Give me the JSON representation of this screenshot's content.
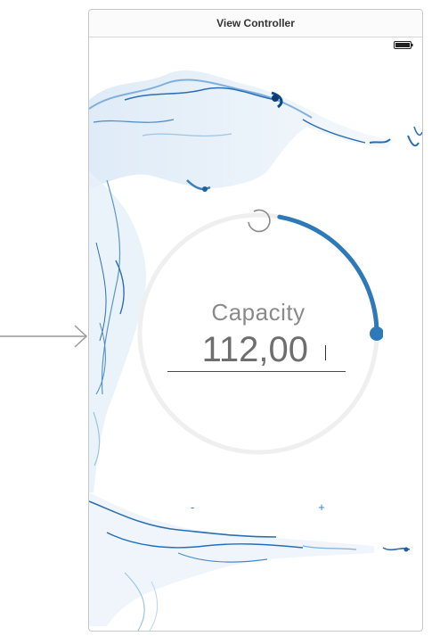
{
  "scene": {
    "title": "View Controller"
  },
  "gauge": {
    "label": "Capacity",
    "value": "112,00",
    "progress_fraction": 0.25,
    "track_color": "#eeeeee",
    "progress_color": "#2e7ab8",
    "reset_icon": "refresh-icon"
  },
  "stepper": {
    "minus_label": "-",
    "plus_label": "+"
  },
  "status_bar": {
    "battery_icon": "battery-icon"
  },
  "colors": {
    "water": "#1f6fbf",
    "water_light": "#a8cbe8"
  }
}
